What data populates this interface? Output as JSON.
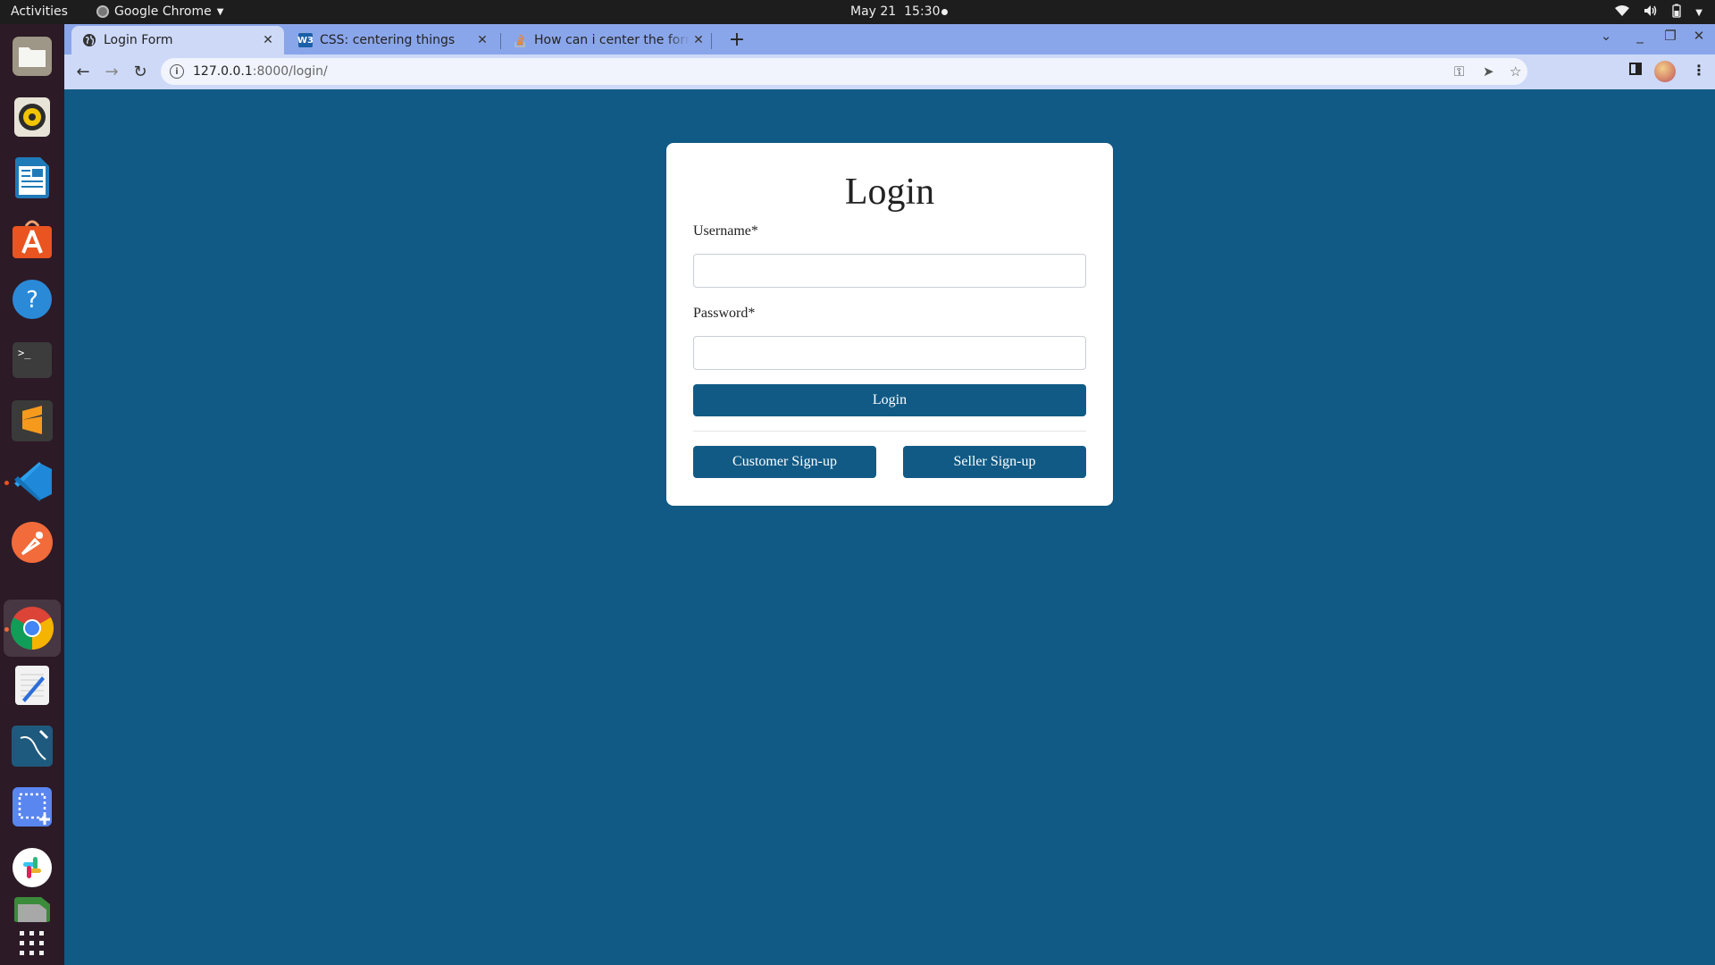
{
  "system": {
    "activities_label": "Activities",
    "app_name": "Google Chrome",
    "date": "May 21",
    "time": "15:30"
  },
  "dock": {
    "apps": [
      {
        "name": "files",
        "running": false
      },
      {
        "name": "rhythmbox",
        "running": false
      },
      {
        "name": "libreoffice-writer",
        "running": false
      },
      {
        "name": "ubuntu-software",
        "running": false
      },
      {
        "name": "help",
        "running": false
      },
      {
        "name": "terminal",
        "running": false
      },
      {
        "name": "sublime-text",
        "running": false
      },
      {
        "name": "vscode",
        "running": true
      },
      {
        "name": "postman",
        "running": false
      },
      {
        "name": "chrome",
        "running": true,
        "focused": true
      },
      {
        "name": "text-editor",
        "running": false
      },
      {
        "name": "mysql-workbench",
        "running": false
      },
      {
        "name": "screenshot",
        "running": false
      },
      {
        "name": "slack",
        "running": false
      },
      {
        "name": "libreoffice-impress",
        "running": false
      },
      {
        "name": "show-applications",
        "running": false
      }
    ]
  },
  "browser": {
    "tabs": [
      {
        "title": "Login Form",
        "favicon": "globe",
        "active": true
      },
      {
        "title": "CSS: centering things",
        "favicon": "W3",
        "active": false
      },
      {
        "title": "How can i center the form",
        "favicon": "stackoverflow",
        "active": false
      }
    ],
    "new_tab_label": "+",
    "url_host": "127.0.0.1",
    "url_rest": ":8000/login/"
  },
  "login_form": {
    "title": "Login",
    "username_label": "Username*",
    "username_value": "",
    "password_label": "Password*",
    "password_value": "",
    "login_button": "Login",
    "customer_signup_button": "Customer Sign-up",
    "seller_signup_button": "Seller Sign-up"
  },
  "colors": {
    "page_background": "#115a85",
    "button_primary": "#115a85",
    "card_background": "#ffffff",
    "tab_strip": "#8aa6ea",
    "active_tab": "#cdd9f7"
  }
}
